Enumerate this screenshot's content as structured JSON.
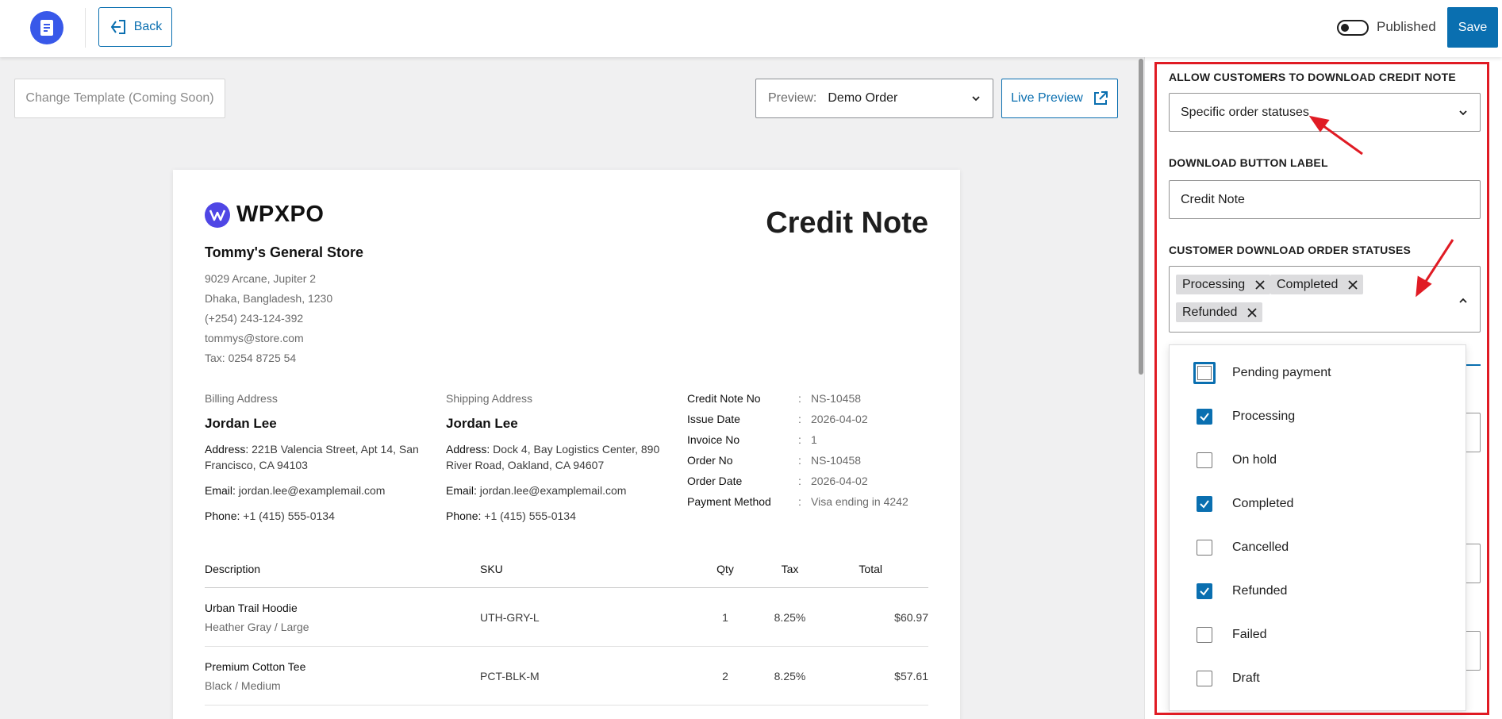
{
  "topbar": {
    "logo_icon": "receipt-icon",
    "back_label": "Back",
    "published_label": "Published",
    "published_on": false,
    "save_label": "Save"
  },
  "canvas": {
    "change_template_label": "Change Template (Coming Soon)",
    "preview_label": "Preview:",
    "preview_value": "Demo Order",
    "live_preview_label": "Live Preview"
  },
  "document": {
    "brand": "WPXPO",
    "title": "Credit Note",
    "store": {
      "name": "Tommy's General Store",
      "lines": [
        "9029 Arcane, Jupiter 2",
        "Dhaka, Bangladesh, 1230",
        "(+254) 243-124-392",
        "tommys@store.com",
        "Tax: 0254 8725 54"
      ]
    },
    "billing": {
      "caption": "Billing Address",
      "name": "Jordan Lee",
      "address_key": "Address:",
      "address": "221B Valencia Street, Apt 14, San Francisco, CA 94103",
      "email_key": "Email:",
      "email": "jordan.lee@examplemail.com",
      "phone_key": "Phone:",
      "phone": "+1 (415) 555-0134"
    },
    "shipping": {
      "caption": "Shipping Address",
      "name": "Jordan Lee",
      "address_key": "Address:",
      "address": "Dock 4, Bay Logistics Center, 890 River Road, Oakland, CA 94607",
      "email_key": "Email:",
      "email": "jordan.lee@examplemail.com",
      "phone_key": "Phone:",
      "phone": "+1 (415) 555-0134"
    },
    "meta": [
      {
        "k": "Credit Note No",
        "v": "NS-10458"
      },
      {
        "k": "Issue Date",
        "v": "2026-04-02"
      },
      {
        "k": "Invoice No",
        "v": "1"
      },
      {
        "k": "Order No",
        "v": "NS-10458"
      },
      {
        "k": "Order Date",
        "v": "2026-04-02"
      },
      {
        "k": "Payment Method",
        "v": "Visa ending in 4242"
      }
    ],
    "table": {
      "headers": [
        "Description",
        "SKU",
        "Qty",
        "Tax",
        "Total"
      ],
      "rows": [
        {
          "name": "Urban Trail Hoodie",
          "variant": "Heather Gray / Large",
          "sku": "UTH-GRY-L",
          "qty": "1",
          "tax": "8.25%",
          "total": "$60.97"
        },
        {
          "name": "Premium Cotton Tee",
          "variant": "Black / Medium",
          "sku": "PCT-BLK-M",
          "qty": "2",
          "tax": "8.25%",
          "total": "$57.61"
        }
      ]
    }
  },
  "settings": {
    "allow_label": "ALLOW CUSTOMERS TO DOWNLOAD CREDIT NOTE",
    "allow_value": "Specific order statuses",
    "button_label_label": "DOWNLOAD BUTTON LABEL",
    "button_label_value": "Credit Note",
    "statuses_label": "CUSTOMER DOWNLOAD ORDER STATUSES",
    "selected_tags": [
      "Processing",
      "Completed",
      "Refunded"
    ],
    "options": [
      {
        "label": "Pending payment",
        "checked": false
      },
      {
        "label": "Processing",
        "checked": true
      },
      {
        "label": "On hold",
        "checked": false
      },
      {
        "label": "Completed",
        "checked": true
      },
      {
        "label": "Cancelled",
        "checked": false
      },
      {
        "label": "Refunded",
        "checked": true
      },
      {
        "label": "Failed",
        "checked": false
      },
      {
        "label": "Draft",
        "checked": false
      }
    ]
  },
  "colors": {
    "accent": "#0a6fb0",
    "highlight": "#e01b24",
    "brand": "#3858e9"
  }
}
